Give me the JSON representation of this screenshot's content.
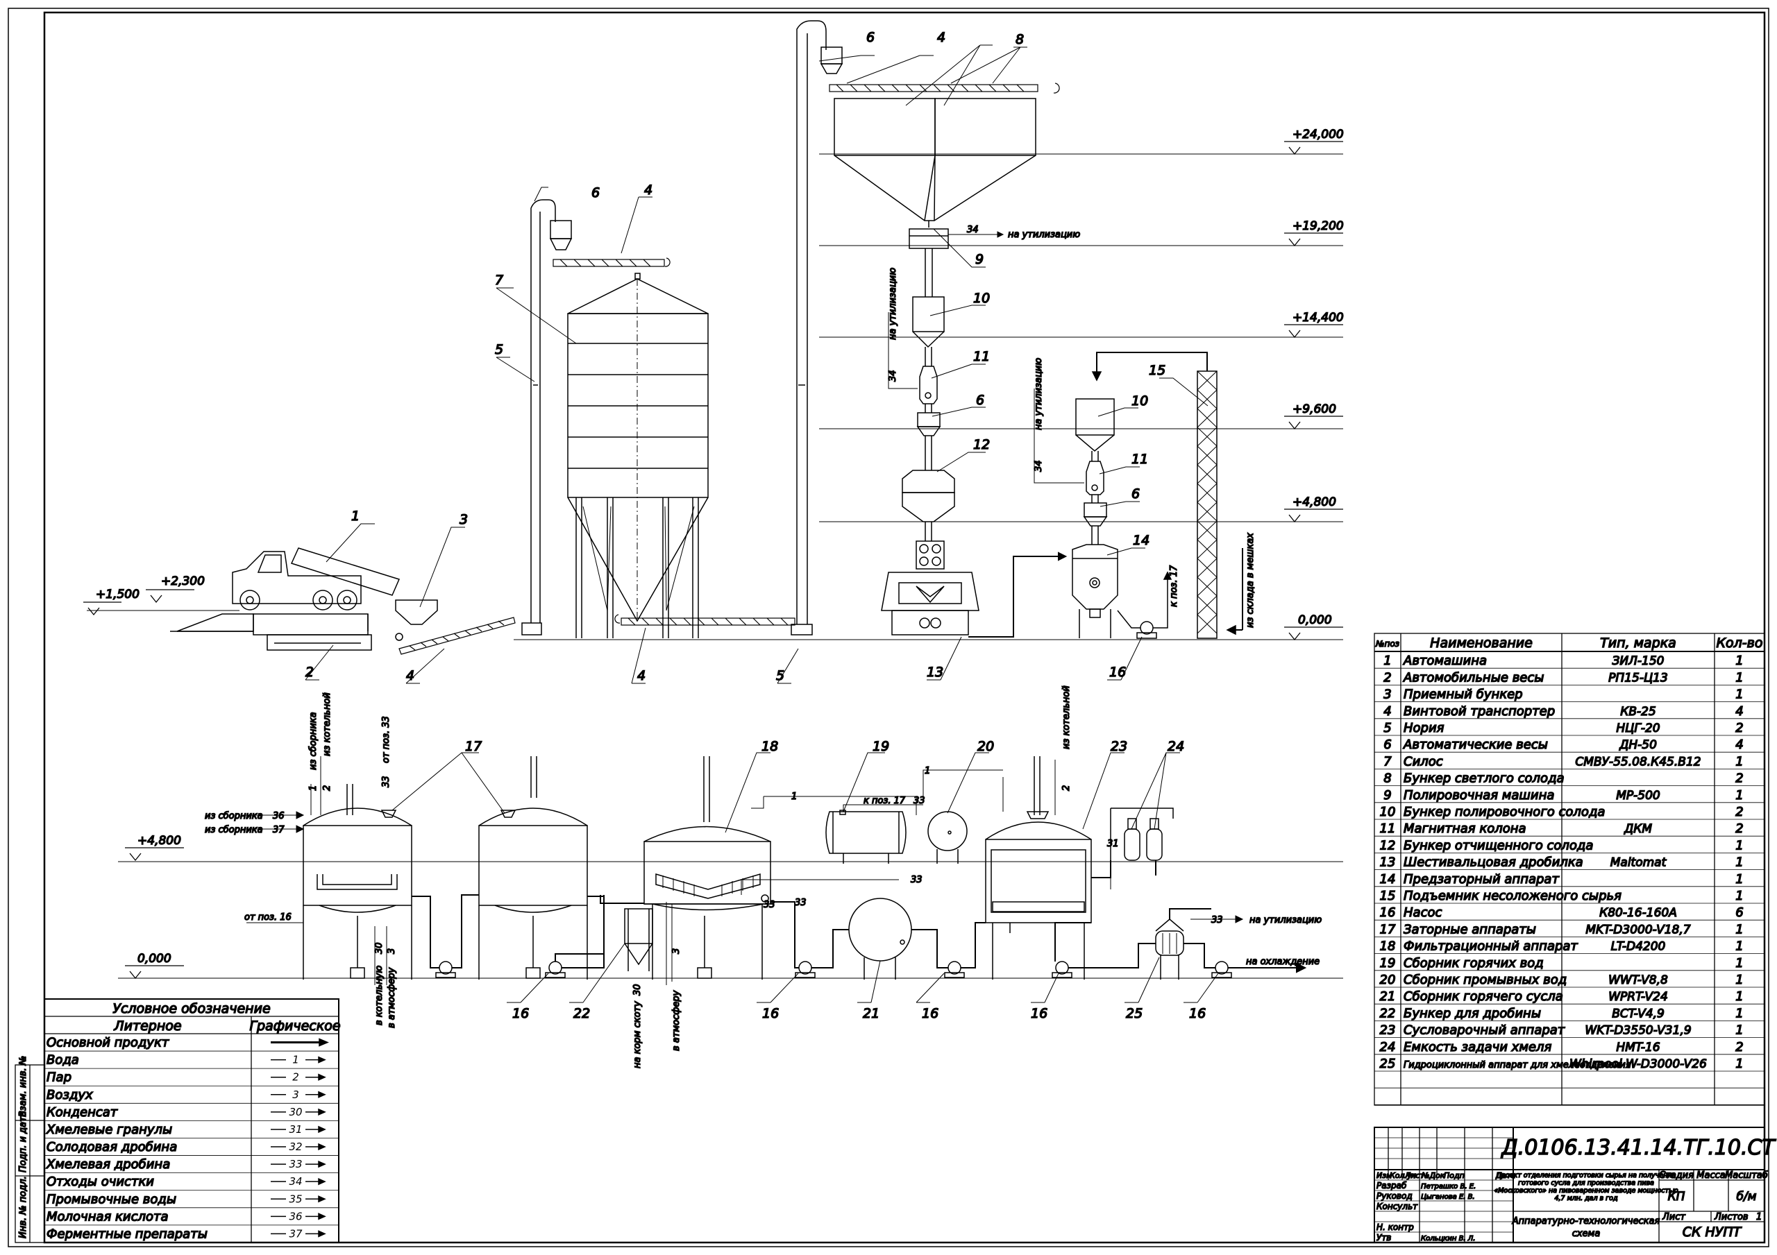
{
  "elevations": [
    {
      "label": "+24,000"
    },
    {
      "label": "+19,200"
    },
    {
      "label": "+14,400"
    },
    {
      "label": "+9,600"
    },
    {
      "label": "+4,800"
    },
    {
      "label": "0,000"
    },
    {
      "label": "+1,500"
    },
    {
      "label": "+2,300"
    },
    {
      "label": "+4,800"
    },
    {
      "label": "0,000"
    }
  ],
  "flow_notes": {
    "to_disposal_top": "на утилизацию",
    "to_disposal_mid": "на утилизацию",
    "to_disposal_right": "на утилизацию",
    "to_disposal_bottom": "на утилизацию",
    "to_pos17_right": "к поз. 17",
    "from_bag_store": "из склада в мешках",
    "from_collector_1": "из сборника",
    "from_boiler": "из котельной",
    "from_pos33": "от поз. 33",
    "from_collector_36": "из сборника",
    "from_collector_37": "из сборника",
    "from_pos16": "от поз. 16",
    "to_boiler": "в котельную",
    "to_atmosphere_1": "в атмосферу",
    "to_feed": "на корм скоту",
    "to_atmosphere_2": "в атмосферу",
    "to_pos17_mid": "к поз. 17",
    "from_boiler_2": "из котельной",
    "to_cooling": "на охлаждение"
  },
  "spec_table": {
    "headers": [
      "№поз",
      "Наименование",
      "Тип, марка",
      "Кол-во"
    ],
    "rows": [
      [
        "1",
        "Автомашина",
        "ЗИЛ-150",
        "1"
      ],
      [
        "2",
        "Автомобильные весы",
        "РП15-Ц13",
        "1"
      ],
      [
        "3",
        "Приемный бункер",
        "",
        "1"
      ],
      [
        "4",
        "Винтовой транспортер",
        "КВ-25",
        "4"
      ],
      [
        "5",
        "Нория",
        "НЦГ-20",
        "2"
      ],
      [
        "6",
        "Автоматические весы",
        "ДН-50",
        "4"
      ],
      [
        "7",
        "Силос",
        "СМВУ-55.08.К45.В12",
        "1"
      ],
      [
        "8",
        "Бункер светлого солода",
        "",
        "2"
      ],
      [
        "9",
        "Полировочная машина",
        "МР-500",
        "1"
      ],
      [
        "10",
        "Бункер полировочного солода",
        "",
        "2"
      ],
      [
        "11",
        "Магнитная колона",
        "ДКМ",
        "2"
      ],
      [
        "12",
        "Бункер отчищенного солода",
        "",
        "1"
      ],
      [
        "13",
        "Шестивальцовая дробилка",
        "Maltomat",
        "1"
      ],
      [
        "14",
        "Предзаторный аппарат",
        "",
        "1"
      ],
      [
        "15",
        "Подъемник несоложеного сырья",
        "",
        "1"
      ],
      [
        "16",
        "Насос",
        "К80-16-160А",
        "6"
      ],
      [
        "17",
        "Заторные аппараты",
        "MKT-D3000-V18,7",
        "1"
      ],
      [
        "18",
        "Фильтрационный аппарат",
        "LT-D4200",
        "1"
      ],
      [
        "19",
        "Сборник горячих вод",
        "",
        "1"
      ],
      [
        "20",
        "Сборник промывных вод",
        "WWT-V8,8",
        "1"
      ],
      [
        "21",
        "Сборник горячего сусла",
        "WPRT-V24",
        "1"
      ],
      [
        "22",
        "Бункер для дробины",
        "BCT-V4,9",
        "1"
      ],
      [
        "23",
        "Сусловарочный аппарат",
        "WKT-D3550-V31,9",
        "1"
      ],
      [
        "24",
        "Емкость задачи хмеля",
        "HMT-16",
        "2"
      ],
      [
        "25",
        "Гидроциклонный аппарат для хмелеотделения",
        "Whirpool W-D3000-V26",
        "1"
      ]
    ]
  },
  "legend": {
    "title": "Условное обозначение",
    "col_literal": "Литерное",
    "col_graphic": "Графическое",
    "rows": [
      {
        "name": "Основной продукт",
        "code": ""
      },
      {
        "name": "Вода",
        "code": "1"
      },
      {
        "name": "Пар",
        "code": "2"
      },
      {
        "name": "Воздух",
        "code": "3"
      },
      {
        "name": "Конденсат",
        "code": "30"
      },
      {
        "name": "Хмелевые гранулы",
        "code": "31"
      },
      {
        "name": "Солодовая дробина",
        "code": "32"
      },
      {
        "name": "Хмелевая дробина",
        "code": "33"
      },
      {
        "name": "Отходы очистки",
        "code": "34"
      },
      {
        "name": "Промывочные воды",
        "code": "35"
      },
      {
        "name": "Молочная кислота",
        "code": "36"
      },
      {
        "name": "Ферментные препараты",
        "code": "37"
      }
    ]
  },
  "side_stamp": [
    "Инв. № подл.",
    "Подп. и дата",
    "Взам. инв. №"
  ],
  "title_block": {
    "doc_code": "Д.0106.13.41.14.ТГ.10.СТ",
    "col_izm": "Изм",
    "col_kol": "Кол.уч",
    "col_list": "Лист",
    "col_ndok": "№Док",
    "col_podp": "Подп",
    "col_data": "Дата",
    "role_razrab": "Разраб",
    "role_rukovod": "Руковод",
    "role_konsult": "Консульт",
    "role_nkontr": "Н. контр",
    "role_utv": "Утв",
    "name_razrab": "Петрашко В. Е.",
    "name_rukovod": "Цыганова Е. В.",
    "name_utv": "Кольцкин В. Л.",
    "project_line1": "Проект отделения подготовки сырья на получение",
    "project_line2": "готового сусла для производства пива",
    "project_line3": "«Московского» на пивоваренном заводе мощностью",
    "project_line4": "4,7 млн. дал в год",
    "stage_label": "Стадия",
    "mass_label": "Масса",
    "scale_label": "Масштаб",
    "stage_value": "КП",
    "scale_value": "б/м",
    "sheet_label": "Лист",
    "sheets_label": "Листов",
    "sheets_value": "1",
    "scheme_line1": "Аппаратурно-технологическая",
    "scheme_line2": "схема",
    "org": "СК НУПТ"
  },
  "callouts": {
    "c1": "1",
    "c2": "2",
    "c3": "3",
    "c4a": "4",
    "c4b": "4",
    "c4c": "4",
    "c4d": "4",
    "c5a": "5",
    "c5b": "5",
    "c6a": "6",
    "c6b": "6",
    "c6c": "6",
    "c6d": "6",
    "c7": "7",
    "c8": "8",
    "c9": "9",
    "c10a": "10",
    "c10b": "10",
    "c11a": "11",
    "c11b": "11",
    "c12": "12",
    "c13": "13",
    "c14": "14",
    "c15": "15",
    "c16a": "16",
    "c16b": "16",
    "c16c": "16",
    "c16d": "16",
    "c16e": "16",
    "c16f": "16",
    "c17": "17",
    "c18": "18",
    "c19": "19",
    "c20": "20",
    "c21": "21",
    "c22": "22",
    "c23": "23",
    "c24": "24",
    "c25": "25"
  },
  "line_codes": {
    "l34a": "34",
    "l34b": "34",
    "l34c": "34",
    "l1a": "1",
    "l2a": "2",
    "l33a": "33",
    "l36": "36",
    "l37": "37",
    "l30a": "30",
    "l3a": "3",
    "l1b": "1",
    "l33b": "33",
    "l33c": "33",
    "l33d": "33",
    "l1c": "1",
    "l2b": "2",
    "l31": "31",
    "l33e": "33",
    "l30b": "30",
    "l3b": "3",
    "l33f": "33"
  }
}
